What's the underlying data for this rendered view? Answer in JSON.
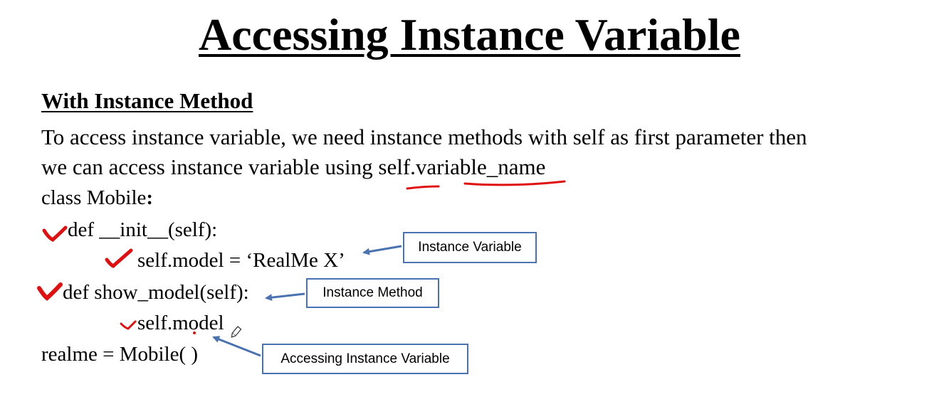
{
  "title": "Accessing Instance Variable",
  "section_heading": "With Instance Method",
  "paragraph": {
    "line1": "To access instance variable, we need instance methods with self as first parameter then",
    "line2_prefix": "we can access instance variable using ",
    "line2_highlight": "self.variable_name"
  },
  "code": {
    "line1_text": "class Mobile",
    "line1_colon": ":",
    "line2": "def __init__(self):",
    "line3": "self.model = ‘RealMe X’",
    "line4": "def show_model(self):",
    "line5": "self.model",
    "line6": "realme = Mobile( )"
  },
  "callouts": {
    "instance_variable": "Instance Variable",
    "instance_method": "Instance Method",
    "accessing_instance_variable": "Accessing Instance Variable"
  },
  "colors": {
    "annotation_red": "#e01010",
    "callout_blue": "#4a72b0"
  }
}
